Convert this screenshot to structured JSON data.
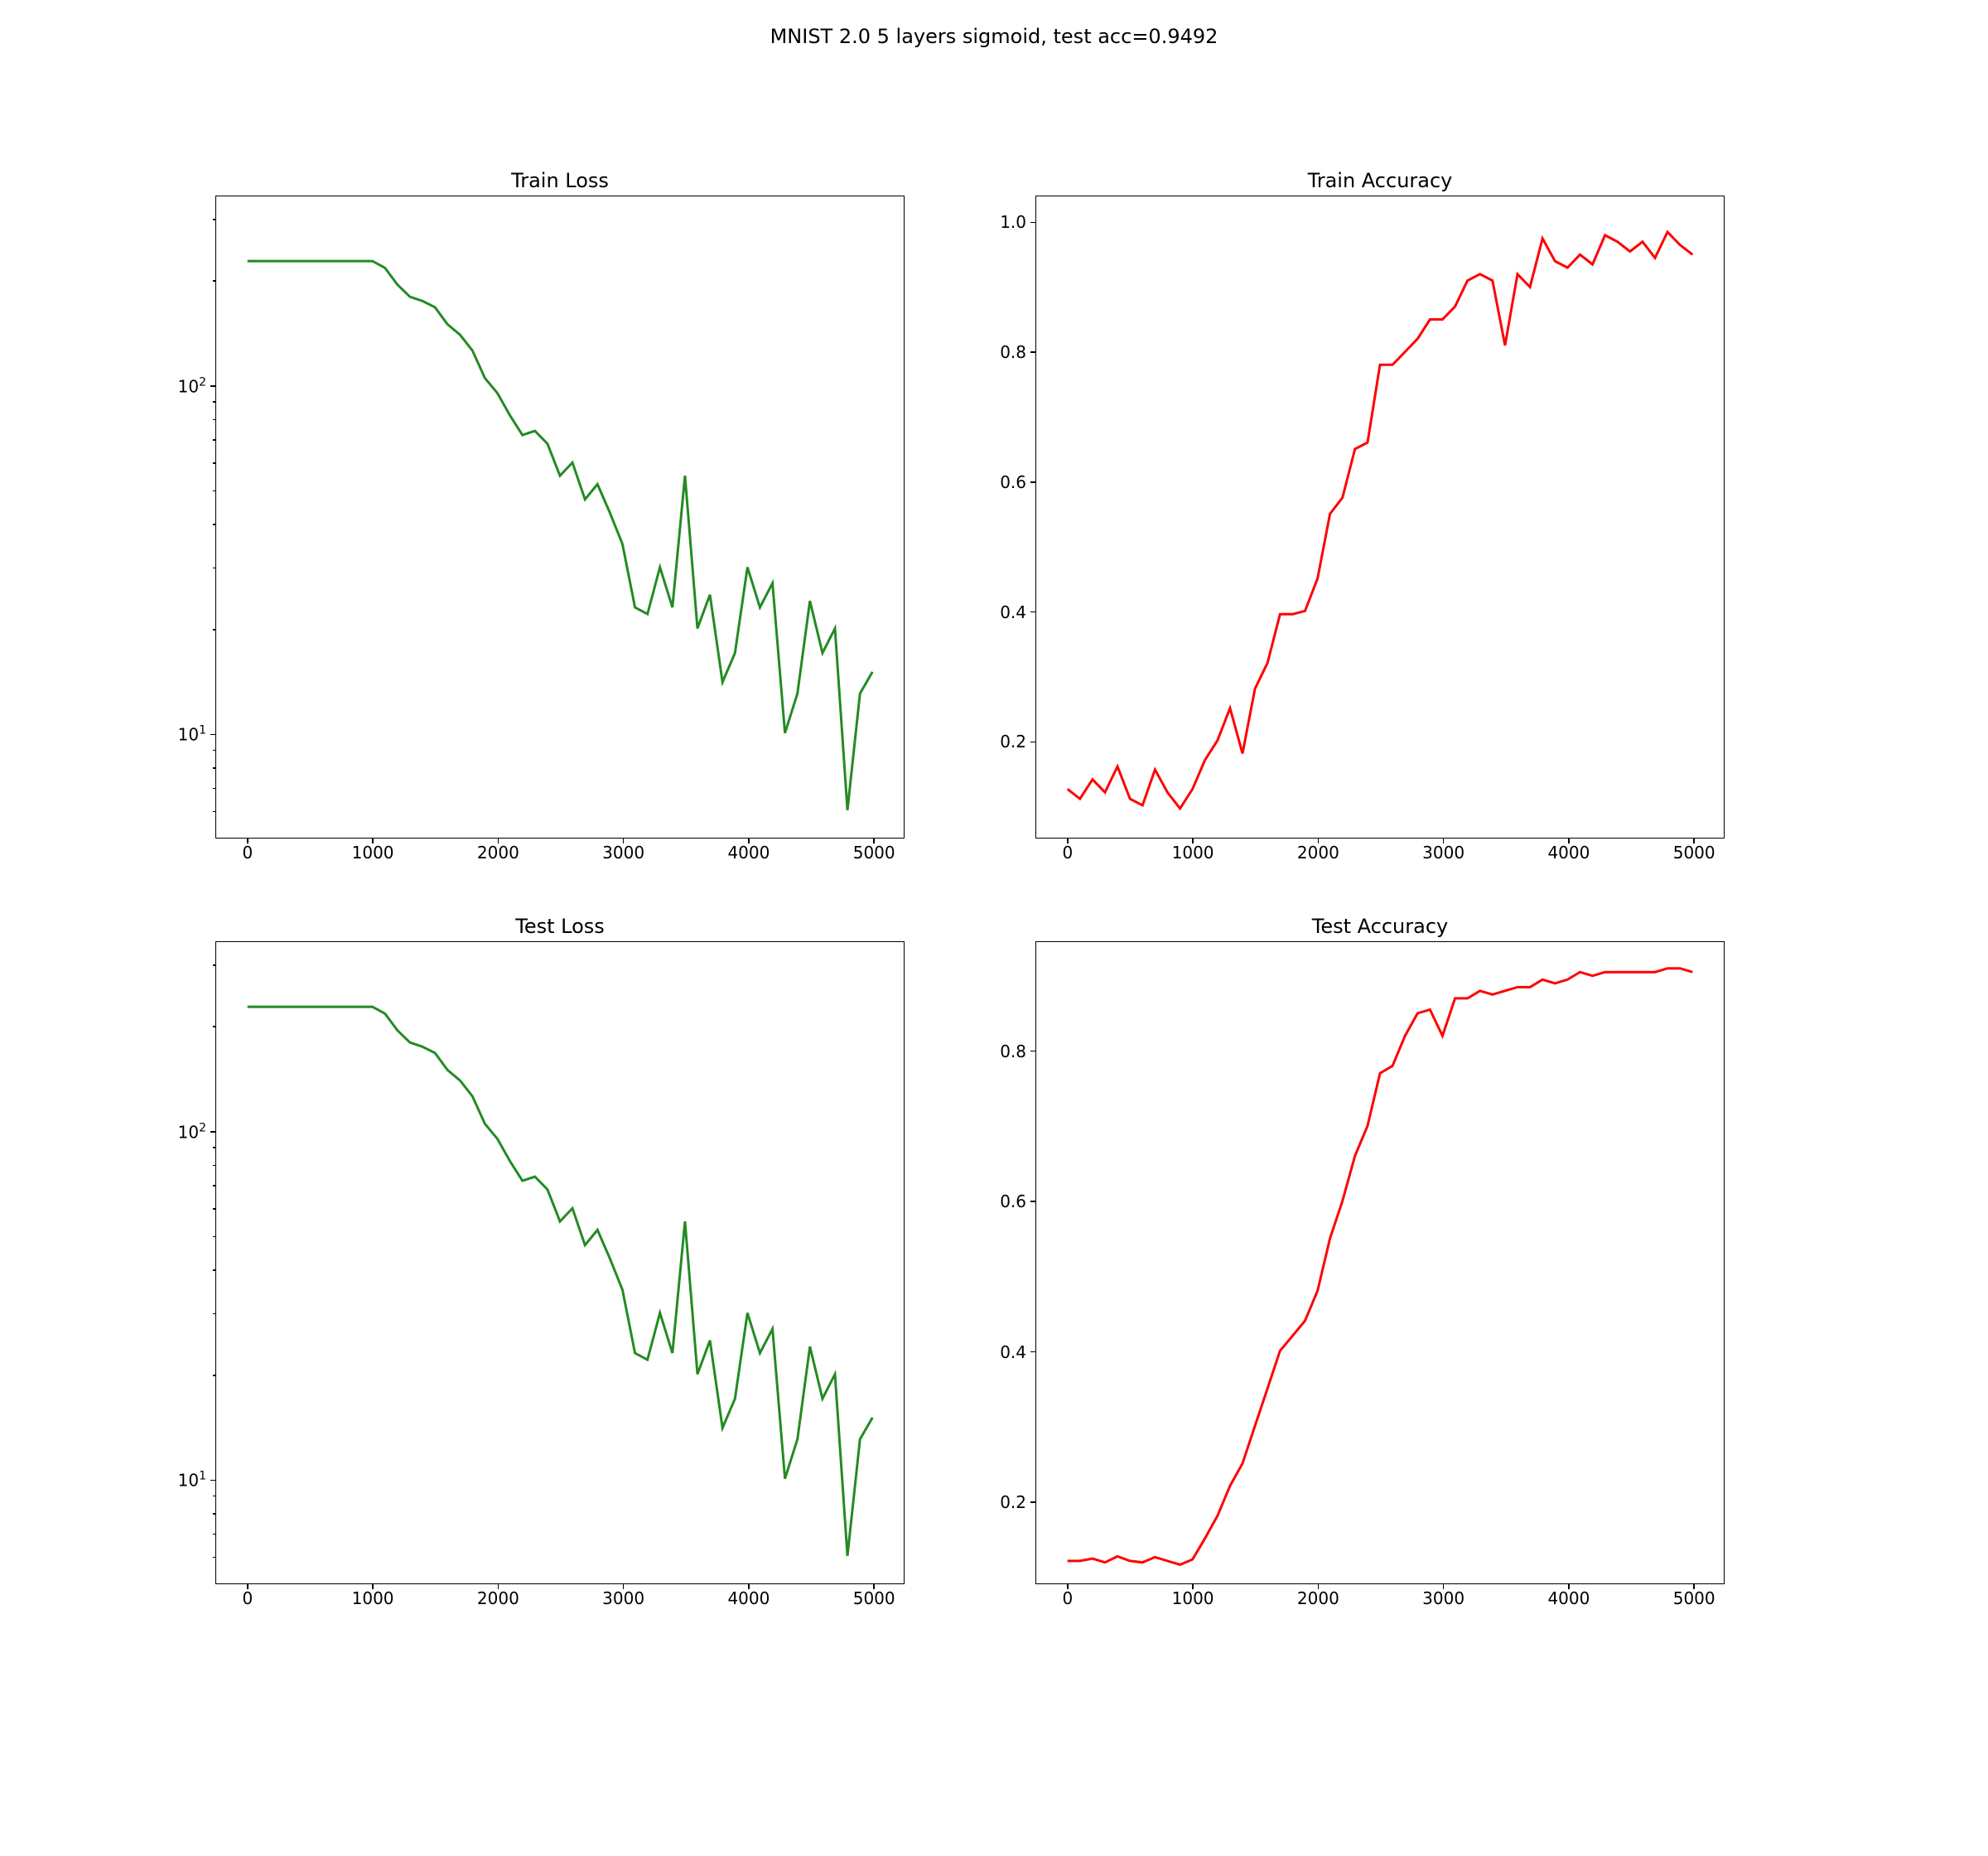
{
  "suptitle": "MNIST 2.0 5 layers sigmoid, test acc=0.9492",
  "colors": {
    "loss": "#228B22",
    "acc": "#ff0000"
  },
  "x": [
    0,
    100,
    200,
    300,
    400,
    500,
    600,
    700,
    800,
    900,
    1000,
    1100,
    1200,
    1300,
    1400,
    1500,
    1600,
    1700,
    1800,
    1900,
    2000,
    2100,
    2200,
    2300,
    2400,
    2500,
    2600,
    2700,
    2800,
    2900,
    3000,
    3100,
    3200,
    3300,
    3400,
    3500,
    3600,
    3700,
    3800,
    3900,
    4000,
    4100,
    4200,
    4300,
    4400,
    4500,
    4600,
    4700,
    4800,
    4900,
    5000
  ],
  "x_ticks_major": [
    0,
    1000,
    2000,
    3000,
    4000,
    5000
  ],
  "x_range": [
    -250,
    5250
  ],
  "charts": {
    "train_loss": {
      "title": "Train Loss",
      "color_key": "loss",
      "yscale": "log",
      "y_range": [
        5,
        350
      ],
      "y_ticks_major": [
        10,
        100
      ],
      "y_tick_labels": [
        "10¹",
        "10²"
      ],
      "y_ticks_minor": [
        6,
        7,
        8,
        9,
        20,
        30,
        40,
        50,
        60,
        70,
        80,
        90,
        200,
        300
      ],
      "values": [
        228,
        228,
        228,
        228,
        228,
        228,
        228,
        228,
        228,
        228,
        228,
        218,
        195,
        180,
        175,
        168,
        150,
        140,
        126,
        105,
        95,
        82,
        72,
        74,
        68,
        55,
        60,
        47,
        52,
        43,
        35,
        23,
        22,
        30,
        23,
        55,
        20,
        25,
        14,
        17,
        30,
        23,
        27,
        10,
        13,
        24,
        17,
        20,
        6,
        13,
        15
      ]
    },
    "train_accuracy": {
      "title": "Train Accuracy",
      "color_key": "acc",
      "yscale": "linear",
      "y_range": [
        0.05,
        1.04
      ],
      "y_ticks_major": [
        0.2,
        0.4,
        0.6,
        0.8,
        1.0
      ],
      "y_tick_labels": [
        "0.2",
        "0.4",
        "0.6",
        "0.8",
        "1.0"
      ],
      "y_ticks_minor": [],
      "values": [
        0.125,
        0.11,
        0.14,
        0.12,
        0.16,
        0.11,
        0.1,
        0.155,
        0.12,
        0.095,
        0.125,
        0.17,
        0.2,
        0.25,
        0.18,
        0.28,
        0.32,
        0.395,
        0.395,
        0.4,
        0.45,
        0.55,
        0.575,
        0.65,
        0.66,
        0.78,
        0.78,
        0.8,
        0.82,
        0.85,
        0.85,
        0.87,
        0.91,
        0.92,
        0.91,
        0.81,
        0.92,
        0.9,
        0.975,
        0.94,
        0.93,
        0.95,
        0.935,
        0.98,
        0.97,
        0.955,
        0.97,
        0.945,
        0.985,
        0.965,
        0.95
      ]
    },
    "test_loss": {
      "title": "Test Loss",
      "color_key": "loss",
      "yscale": "log",
      "y_range": [
        5,
        350
      ],
      "y_ticks_major": [
        10,
        100
      ],
      "y_tick_labels": [
        "10¹",
        "10²"
      ],
      "y_ticks_minor": [
        6,
        7,
        8,
        9,
        20,
        30,
        40,
        50,
        60,
        70,
        80,
        90,
        200,
        300
      ],
      "values": [
        228,
        228,
        228,
        228,
        228,
        228,
        228,
        228,
        228,
        228,
        228,
        218,
        195,
        180,
        175,
        168,
        150,
        140,
        126,
        105,
        95,
        82,
        72,
        74,
        68,
        55,
        60,
        47,
        52,
        43,
        35,
        23,
        22,
        30,
        23,
        55,
        20,
        25,
        14,
        17,
        30,
        23,
        27,
        10,
        13,
        24,
        17,
        20,
        6,
        13,
        15
      ]
    },
    "test_accuracy": {
      "title": "Test Accuracy",
      "color_key": "acc",
      "yscale": "linear",
      "y_range": [
        0.09,
        0.945
      ],
      "y_ticks_major": [
        0.2,
        0.4,
        0.6,
        0.8
      ],
      "y_tick_labels": [
        "0.2",
        "0.4",
        "0.6",
        "0.8"
      ],
      "y_ticks_minor": [],
      "values": [
        0.12,
        0.12,
        0.123,
        0.118,
        0.126,
        0.12,
        0.118,
        0.125,
        0.12,
        0.115,
        0.122,
        0.15,
        0.18,
        0.22,
        0.25,
        0.3,
        0.35,
        0.4,
        0.42,
        0.44,
        0.48,
        0.55,
        0.6,
        0.66,
        0.7,
        0.77,
        0.78,
        0.82,
        0.85,
        0.855,
        0.82,
        0.87,
        0.87,
        0.88,
        0.875,
        0.88,
        0.885,
        0.885,
        0.895,
        0.89,
        0.895,
        0.905,
        0.9,
        0.905,
        0.905,
        0.905,
        0.905,
        0.905,
        0.91,
        0.91,
        0.905
      ]
    }
  },
  "chart_data": [
    {
      "type": "line",
      "title": "Train Loss",
      "xlabel": "",
      "ylabel": "",
      "xlim": [
        -250,
        5250
      ],
      "yscale": "log",
      "x": [
        0,
        100,
        200,
        300,
        400,
        500,
        600,
        700,
        800,
        900,
        1000,
        1100,
        1200,
        1300,
        1400,
        1500,
        1600,
        1700,
        1800,
        1900,
        2000,
        2100,
        2200,
        2300,
        2400,
        2500,
        2600,
        2700,
        2800,
        2900,
        3000,
        3100,
        3200,
        3300,
        3400,
        3500,
        3600,
        3700,
        3800,
        3900,
        4000,
        4100,
        4200,
        4300,
        4400,
        4500,
        4600,
        4700,
        4800,
        4900,
        5000
      ],
      "values": [
        228,
        228,
        228,
        228,
        228,
        228,
        228,
        228,
        228,
        228,
        228,
        218,
        195,
        180,
        175,
        168,
        150,
        140,
        126,
        105,
        95,
        82,
        72,
        74,
        68,
        55,
        60,
        47,
        52,
        43,
        35,
        23,
        22,
        30,
        23,
        55,
        20,
        25,
        14,
        17,
        30,
        23,
        27,
        10,
        13,
        24,
        17,
        20,
        6,
        13,
        15
      ]
    },
    {
      "type": "line",
      "title": "Train Accuracy",
      "xlabel": "",
      "ylabel": "",
      "xlim": [
        -250,
        5250
      ],
      "ylim": [
        0.05,
        1.04
      ],
      "x": [
        0,
        100,
        200,
        300,
        400,
        500,
        600,
        700,
        800,
        900,
        1000,
        1100,
        1200,
        1300,
        1400,
        1500,
        1600,
        1700,
        1800,
        1900,
        2000,
        2100,
        2200,
        2300,
        2400,
        2500,
        2600,
        2700,
        2800,
        2900,
        3000,
        3100,
        3200,
        3300,
        3400,
        3500,
        3600,
        3700,
        3800,
        3900,
        4000,
        4100,
        4200,
        4300,
        4400,
        4500,
        4600,
        4700,
        4800,
        4900,
        5000
      ],
      "values": [
        0.125,
        0.11,
        0.14,
        0.12,
        0.16,
        0.11,
        0.1,
        0.155,
        0.12,
        0.095,
        0.125,
        0.17,
        0.2,
        0.25,
        0.18,
        0.28,
        0.32,
        0.395,
        0.395,
        0.4,
        0.45,
        0.55,
        0.575,
        0.65,
        0.66,
        0.78,
        0.78,
        0.8,
        0.82,
        0.85,
        0.85,
        0.87,
        0.91,
        0.92,
        0.91,
        0.81,
        0.92,
        0.9,
        0.975,
        0.94,
        0.93,
        0.95,
        0.935,
        0.98,
        0.97,
        0.955,
        0.97,
        0.945,
        0.985,
        0.965,
        0.95
      ]
    },
    {
      "type": "line",
      "title": "Test Loss",
      "xlabel": "",
      "ylabel": "",
      "xlim": [
        -250,
        5250
      ],
      "yscale": "log",
      "x": [
        0,
        100,
        200,
        300,
        400,
        500,
        600,
        700,
        800,
        900,
        1000,
        1100,
        1200,
        1300,
        1400,
        1500,
        1600,
        1700,
        1800,
        1900,
        2000,
        2100,
        2200,
        2300,
        2400,
        2500,
        2600,
        2700,
        2800,
        2900,
        3000,
        3100,
        3200,
        3300,
        3400,
        3500,
        3600,
        3700,
        3800,
        3900,
        4000,
        4100,
        4200,
        4300,
        4400,
        4500,
        4600,
        4700,
        4800,
        4900,
        5000
      ],
      "values": [
        228,
        228,
        228,
        228,
        228,
        228,
        228,
        228,
        228,
        228,
        228,
        218,
        195,
        180,
        175,
        168,
        150,
        140,
        126,
        105,
        95,
        82,
        72,
        74,
        68,
        55,
        60,
        47,
        52,
        43,
        35,
        23,
        22,
        30,
        23,
        55,
        20,
        25,
        14,
        17,
        30,
        23,
        27,
        10,
        13,
        24,
        17,
        20,
        6,
        13,
        15
      ]
    },
    {
      "type": "line",
      "title": "Test Accuracy",
      "xlabel": "",
      "ylabel": "",
      "xlim": [
        -250,
        5250
      ],
      "ylim": [
        0.09,
        0.945
      ],
      "x": [
        0,
        100,
        200,
        300,
        400,
        500,
        600,
        700,
        800,
        900,
        1000,
        1100,
        1200,
        1300,
        1400,
        1500,
        1600,
        1700,
        1800,
        1900,
        2000,
        2100,
        2200,
        2300,
        2400,
        2500,
        2600,
        2700,
        2800,
        2900,
        3000,
        3100,
        3200,
        3300,
        3400,
        3500,
        3600,
        3700,
        3800,
        3900,
        4000,
        4100,
        4200,
        4300,
        4400,
        4500,
        4600,
        4700,
        4800,
        4900,
        5000
      ],
      "values": [
        0.12,
        0.12,
        0.123,
        0.118,
        0.126,
        0.12,
        0.118,
        0.125,
        0.12,
        0.115,
        0.122,
        0.15,
        0.18,
        0.22,
        0.25,
        0.3,
        0.35,
        0.4,
        0.42,
        0.44,
        0.48,
        0.55,
        0.6,
        0.66,
        0.7,
        0.77,
        0.78,
        0.82,
        0.85,
        0.855,
        0.82,
        0.87,
        0.87,
        0.88,
        0.875,
        0.88,
        0.885,
        0.885,
        0.895,
        0.89,
        0.895,
        0.905,
        0.9,
        0.905,
        0.905,
        0.905,
        0.905,
        0.905,
        0.91,
        0.91,
        0.905
      ]
    }
  ]
}
